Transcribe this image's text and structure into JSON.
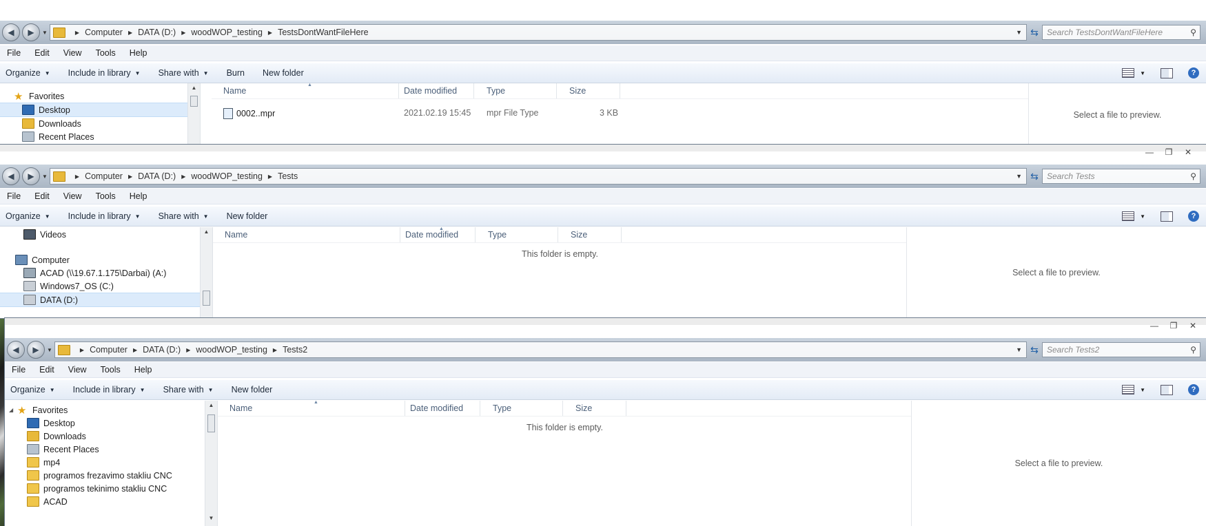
{
  "common": {
    "menu": [
      "File",
      "Edit",
      "View",
      "Tools",
      "Help"
    ],
    "organize": "Organize",
    "include_in_library": "Include in library",
    "share_with": "Share with",
    "burn": "Burn",
    "new_folder": "New folder",
    "columns": [
      "Name",
      "Date modified",
      "Type",
      "Size"
    ],
    "preview_text": "Select a file to preview.",
    "empty_text": "This folder is empty."
  },
  "windows": [
    {
      "breadcrumb": [
        "Computer",
        "DATA (D:)",
        "woodWOP_testing",
        "TestsDontWantFileHere"
      ],
      "search_placeholder": "Search TestsDontWantFileHere",
      "nav_items": [
        "Favorites",
        "Desktop",
        "Downloads",
        "Recent Places"
      ],
      "files": [
        {
          "name": "0002..mpr",
          "date": "2021.02.19 15:45",
          "type": "mpr File Type",
          "size": "3 KB"
        }
      ]
    },
    {
      "breadcrumb": [
        "Computer",
        "DATA (D:)",
        "woodWOP_testing",
        "Tests"
      ],
      "search_placeholder": "Search Tests",
      "nav_items": [
        "Videos",
        "Computer",
        "ACAD (\\\\19.67.1.175\\Darbai) (A:)",
        "Windows7_OS (C:)",
        "DATA (D:)"
      ]
    },
    {
      "breadcrumb": [
        "Computer",
        "DATA (D:)",
        "woodWOP_testing",
        "Tests2"
      ],
      "search_placeholder": "Search Tests2",
      "nav_items": [
        "Favorites",
        "Desktop",
        "Downloads",
        "Recent Places",
        "mp4",
        "programos frezavimo stakliu CNC",
        "programos tekinimo stakliu CNC",
        "ACAD"
      ]
    }
  ]
}
